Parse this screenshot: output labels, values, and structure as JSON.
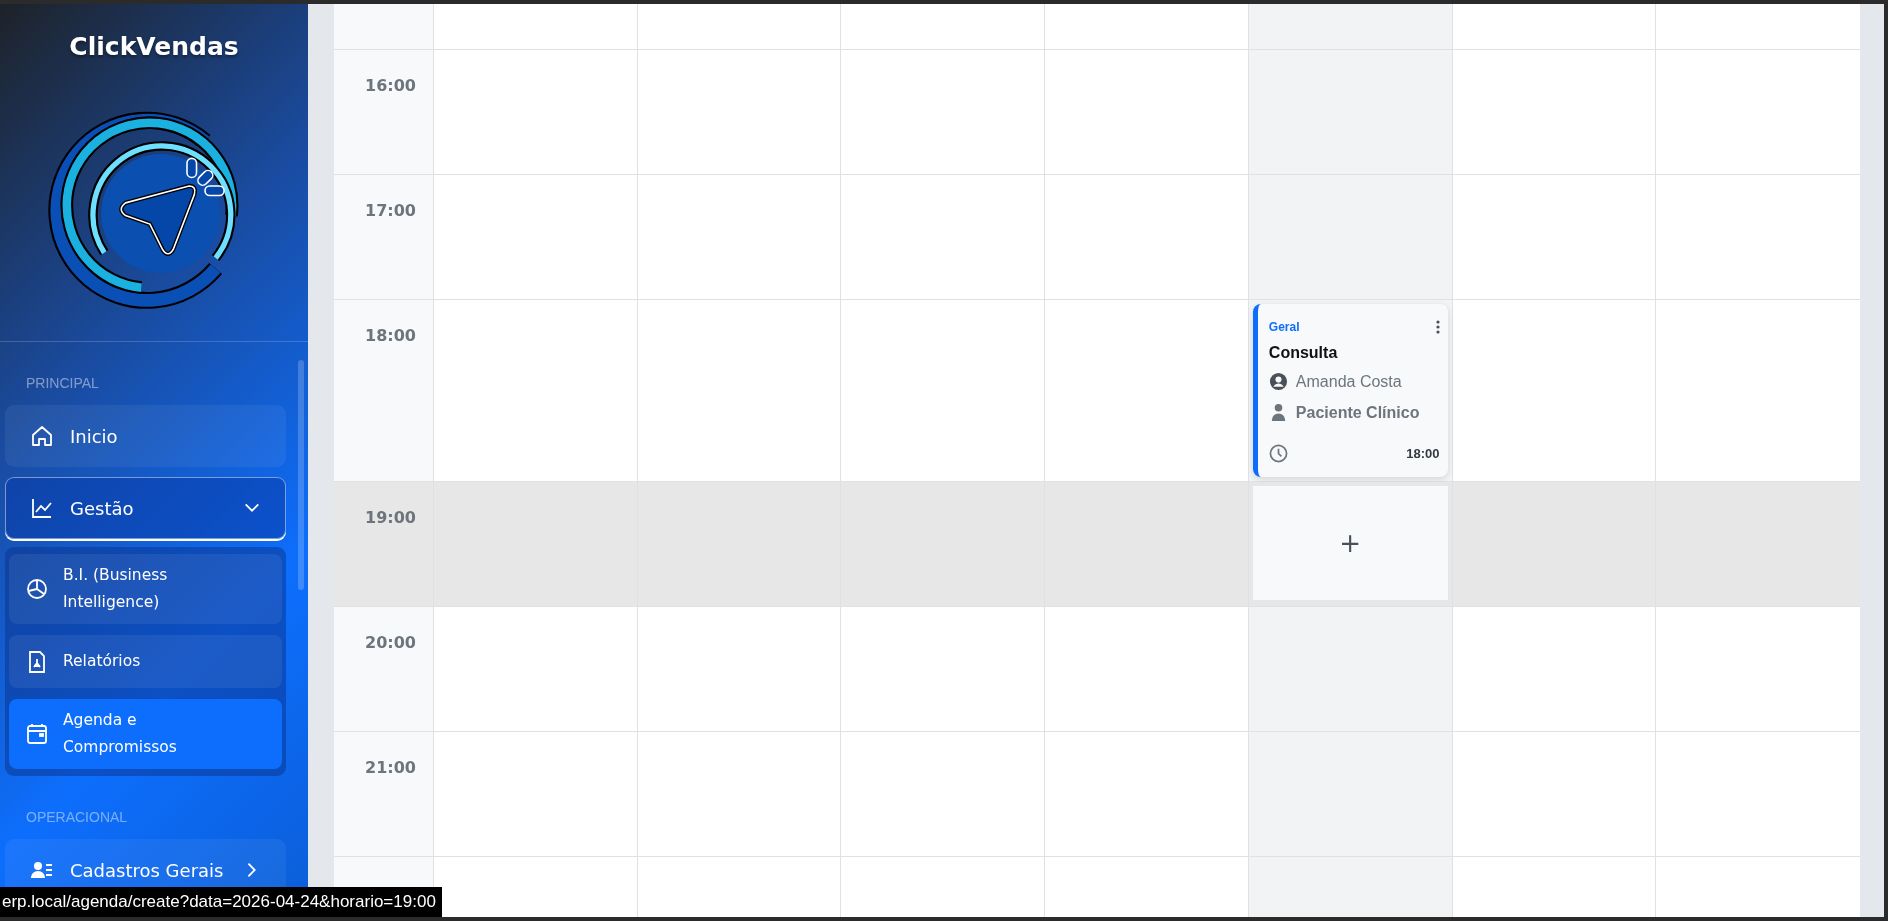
{
  "sidebar": {
    "brand": "ClickVendas",
    "sections": [
      {
        "heading": "PRINCIPAL",
        "items": [
          {
            "label": "Inicio",
            "kind": "link",
            "selected": false
          },
          {
            "label": "Gestão",
            "kind": "group",
            "expanded": true,
            "children": [
              {
                "label": "B.I. (Business Intelligence)",
                "selected": false
              },
              {
                "label": "Relatórios",
                "selected": false
              },
              {
                "label": "Agenda e Compromissos",
                "selected": true
              }
            ]
          }
        ]
      },
      {
        "heading": "OPERACIONAL",
        "items": [
          {
            "label": "Cadastros Gerais",
            "kind": "group",
            "expanded": false
          }
        ]
      }
    ]
  },
  "calendar": {
    "columns": [
      {
        "today": false
      },
      {
        "today": false
      },
      {
        "today": false
      },
      {
        "today": false
      },
      {
        "today": true
      },
      {
        "today": false
      },
      {
        "today": false
      }
    ],
    "slots": [
      {
        "kind": "partial",
        "hovered": false,
        "cells": [
          {
            "kind": "empty"
          },
          {
            "kind": "empty"
          },
          {
            "kind": "empty"
          },
          {
            "kind": "empty"
          },
          {
            "kind": "empty"
          },
          {
            "kind": "empty"
          },
          {
            "kind": "empty"
          }
        ]
      },
      {
        "kind": "hour",
        "time": "16:00",
        "hovered": false,
        "cells": [
          {
            "kind": "empty"
          },
          {
            "kind": "empty"
          },
          {
            "kind": "empty"
          },
          {
            "kind": "empty"
          },
          {
            "kind": "empty"
          },
          {
            "kind": "empty"
          },
          {
            "kind": "empty"
          }
        ]
      },
      {
        "kind": "hour",
        "time": "17:00",
        "hovered": false,
        "cells": [
          {
            "kind": "empty"
          },
          {
            "kind": "empty"
          },
          {
            "kind": "empty"
          },
          {
            "kind": "empty"
          },
          {
            "kind": "empty"
          },
          {
            "kind": "empty"
          },
          {
            "kind": "empty"
          }
        ]
      },
      {
        "kind": "hour",
        "time": "18:00",
        "hovered": false,
        "cells": [
          {
            "kind": "empty"
          },
          {
            "kind": "empty"
          },
          {
            "kind": "empty"
          },
          {
            "kind": "empty"
          },
          {
            "kind": "event",
            "category": "Geral",
            "title": "Consulta",
            "person": "Amanda Costa",
            "type": "Paciente Clínico",
            "time": "18:00"
          },
          {
            "kind": "empty"
          },
          {
            "kind": "empty"
          }
        ]
      },
      {
        "kind": "hour",
        "time": "19:00",
        "hovered": true,
        "cells": [
          {
            "kind": "empty"
          },
          {
            "kind": "empty"
          },
          {
            "kind": "empty"
          },
          {
            "kind": "empty"
          },
          {
            "kind": "add",
            "label": "+"
          },
          {
            "kind": "empty"
          },
          {
            "kind": "empty"
          }
        ]
      },
      {
        "kind": "hour",
        "time": "20:00",
        "hovered": false,
        "cells": [
          {
            "kind": "empty"
          },
          {
            "kind": "empty"
          },
          {
            "kind": "empty"
          },
          {
            "kind": "empty"
          },
          {
            "kind": "empty"
          },
          {
            "kind": "empty"
          },
          {
            "kind": "empty"
          }
        ]
      },
      {
        "kind": "hour",
        "time": "21:00",
        "hovered": false,
        "cells": [
          {
            "kind": "empty"
          },
          {
            "kind": "empty"
          },
          {
            "kind": "empty"
          },
          {
            "kind": "empty"
          },
          {
            "kind": "empty"
          },
          {
            "kind": "empty"
          },
          {
            "kind": "empty"
          }
        ]
      },
      {
        "kind": "partial",
        "hovered": false,
        "cells": [
          {
            "kind": "empty"
          },
          {
            "kind": "empty"
          },
          {
            "kind": "empty"
          },
          {
            "kind": "empty"
          },
          {
            "kind": "empty"
          },
          {
            "kind": "empty"
          },
          {
            "kind": "empty"
          }
        ]
      }
    ]
  },
  "status_url": "erp.local/agenda/create?data=2026-04-24&horario=19:00"
}
